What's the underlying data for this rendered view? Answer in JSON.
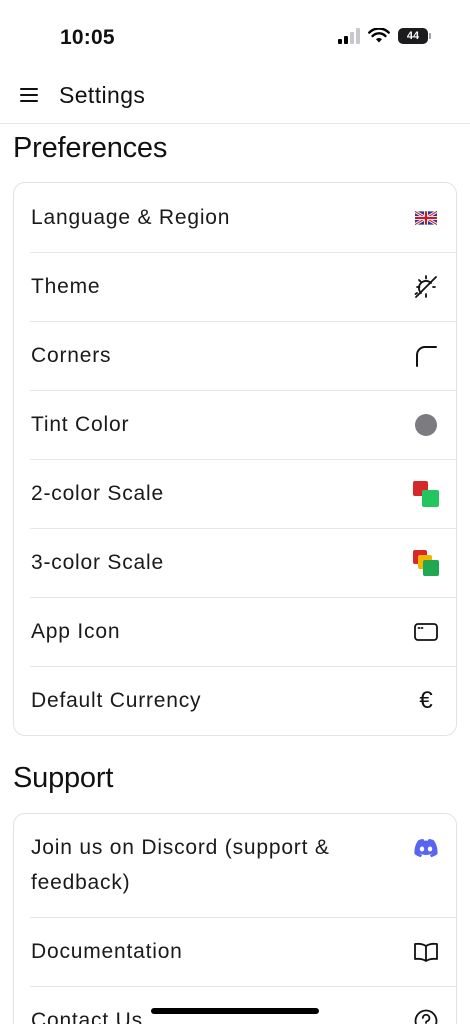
{
  "status": {
    "time": "10:05",
    "battery": "44"
  },
  "header": {
    "title": "Settings"
  },
  "preferences": {
    "title": "Preferences",
    "items": [
      {
        "label": "Language & Region",
        "icon": "uk-flag-icon"
      },
      {
        "label": "Theme",
        "icon": "theme-icon"
      },
      {
        "label": "Corners",
        "icon": "corner-icon"
      },
      {
        "label": "Tint Color",
        "icon": "tint-dot-icon"
      },
      {
        "label": "2-color Scale",
        "icon": "two-color-scale-icon"
      },
      {
        "label": "3-color Scale",
        "icon": "three-color-scale-icon"
      },
      {
        "label": "App Icon",
        "icon": "app-window-icon"
      },
      {
        "label": "Default Currency",
        "icon": "euro-icon"
      }
    ]
  },
  "support": {
    "title": "Support",
    "items": [
      {
        "label": "Join us on Discord (support & feedback)",
        "icon": "discord-icon"
      },
      {
        "label": "Documentation",
        "icon": "book-icon"
      },
      {
        "label": "Contact Us",
        "icon": "help-circle-icon"
      }
    ]
  },
  "colors": {
    "tint": "#7c7c80",
    "scale_red": "#d62828",
    "scale_green": "#22c55e",
    "scale_yellow": "#f5b400",
    "discord": "#5865f2"
  }
}
